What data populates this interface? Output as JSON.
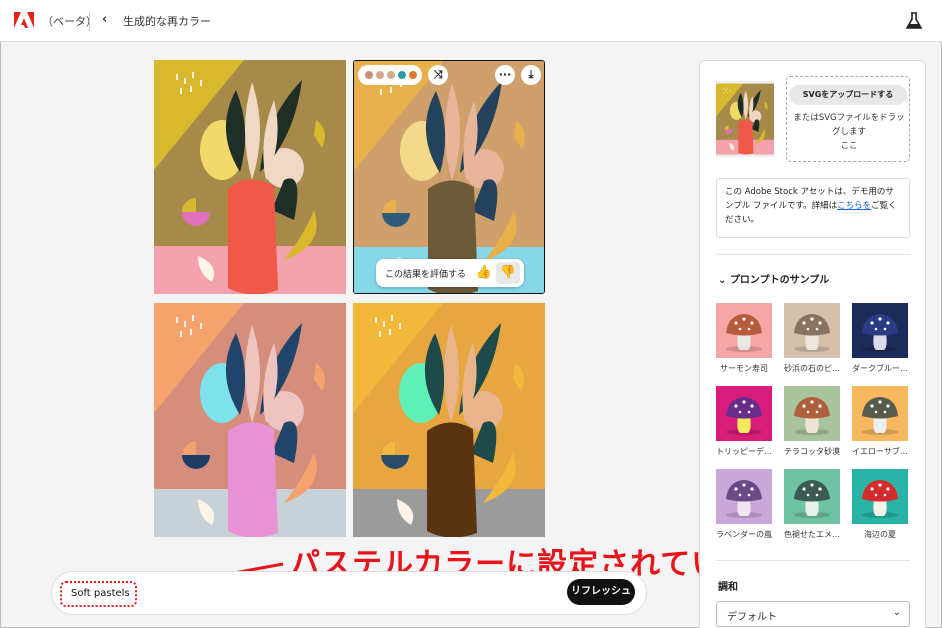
{
  "header": {
    "beta_label": "（ベータ）",
    "back_icon": "chevron-left-icon",
    "page_title": "生成的な再カラー",
    "flask_icon": "flask-icon"
  },
  "results": {
    "swatches": [
      "#c98f78",
      "#d6a78c",
      "#c9b08a",
      "#2e9aa7",
      "#d9782e"
    ],
    "rate_label": "この結果を評価する"
  },
  "prompt": {
    "value": "Soft pastels",
    "refresh_label": "リフレッシュ"
  },
  "annotation": {
    "text": "パステルカラーに設定されている",
    "color": "#e8141c"
  },
  "sidebar": {
    "upload_button": "SVGをアップロードする",
    "upload_hint": "またはSVGファイルをドラッグします\nここ",
    "info_before": "この Adobe Stock アセットは、デモ用のサンプル ファイルです。詳細は",
    "info_link": "こちらを",
    "info_after": "ご覧ください。",
    "samples_title": "プロンプトのサンプル",
    "samples": [
      {
        "label": "サーモン寿司",
        "bg": "#f4a7a6",
        "cap": "#b85a3c",
        "stem": "#e8e6e3"
      },
      {
        "label": "砂浜の石のビ…",
        "bg": "#d5c0ac",
        "cap": "#8a7160",
        "stem": "#ece6df"
      },
      {
        "label": "ダークブルー…",
        "bg": "#1c2c5b",
        "cap": "#2b3c86",
        "stem": "#d9d9ee"
      },
      {
        "label": "トリッピーデ…",
        "bg": "#d81d7a",
        "cap": "#6a2b8a",
        "stem": "#f4e860"
      },
      {
        "label": "テラコッタ砂漠",
        "bg": "#a9c39c",
        "cap": "#b05f3d",
        "stem": "#efe3d3"
      },
      {
        "label": "イエローサブ…",
        "bg": "#f5b85e",
        "cap": "#5a5a4c",
        "stem": "#eef0f0"
      },
      {
        "label": "ラベンダーの嵐",
        "bg": "#c9a8d9",
        "cap": "#6b4a8a",
        "stem": "#f2e6f6"
      },
      {
        "label": "色褪せたエメ…",
        "bg": "#6fc2a2",
        "cap": "#3b5a53",
        "stem": "#e6f2ec"
      },
      {
        "label": "海辺の夏",
        "bg": "#2bb2a6",
        "cap": "#d42c2c",
        "stem": "#f4f0e6"
      }
    ],
    "harmony_label": "調和",
    "harmony_value": "デフォルト"
  },
  "tiles": [
    {
      "bg": "#a68a4a",
      "stripe": "#d8b82c",
      "floor": "#f3a2ac",
      "vase": "#f0584a",
      "leaf": "#1f2f28",
      "petal": "#f1d8c4",
      "blob": "#f3d96a",
      "accent": "#e06fbe"
    },
    {
      "bg": "#cfa06c",
      "stripe": "#e8b04a",
      "floor": "#86d8e8",
      "vase": "#6b5938",
      "leaf": "#24425c",
      "petal": "#e8b49a",
      "blob": "#f3d98a",
      "accent": "#2f5a7a"
    },
    {
      "bg": "#d58e7c",
      "stripe": "#f6a26c",
      "floor": "#c8d0d8",
      "vase": "#e891d4",
      "leaf": "#21456a",
      "petal": "#eec4c0",
      "blob": "#7ee2ea",
      "accent": "#223b62"
    },
    {
      "bg": "#e8a640",
      "stripe": "#f2b83c",
      "floor": "#9b9b9b",
      "vase": "#5a3412",
      "leaf": "#1f4a4a",
      "petal": "#e8b48c",
      "blob": "#5ef0b8",
      "accent": "#2a4b6a"
    }
  ]
}
